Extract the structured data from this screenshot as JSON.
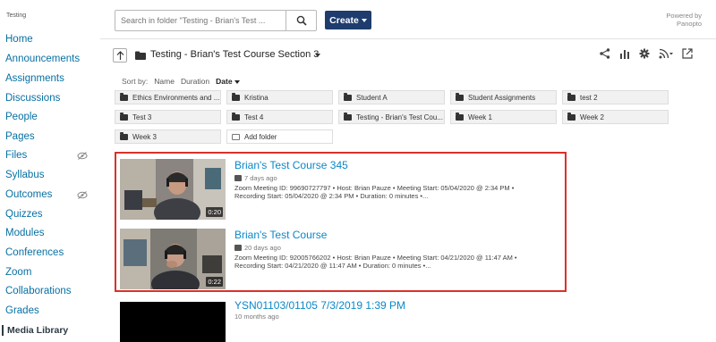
{
  "nav": {
    "course_crumb": "Testing",
    "items": [
      {
        "label": "Home",
        "hidden": false,
        "active": false
      },
      {
        "label": "Announcements",
        "hidden": false,
        "active": false
      },
      {
        "label": "Assignments",
        "hidden": false,
        "active": false
      },
      {
        "label": "Discussions",
        "hidden": false,
        "active": false
      },
      {
        "label": "People",
        "hidden": false,
        "active": false
      },
      {
        "label": "Pages",
        "hidden": false,
        "active": false
      },
      {
        "label": "Files",
        "hidden": true,
        "active": false
      },
      {
        "label": "Syllabus",
        "hidden": false,
        "active": false
      },
      {
        "label": "Outcomes",
        "hidden": true,
        "active": false
      },
      {
        "label": "Quizzes",
        "hidden": false,
        "active": false
      },
      {
        "label": "Modules",
        "hidden": false,
        "active": false
      },
      {
        "label": "Conferences",
        "hidden": false,
        "active": false
      },
      {
        "label": "Zoom",
        "hidden": false,
        "active": false
      },
      {
        "label": "Collaborations",
        "hidden": false,
        "active": false
      },
      {
        "label": "Grades",
        "hidden": false,
        "active": false
      },
      {
        "label": "Media Library",
        "hidden": false,
        "active": true
      }
    ]
  },
  "toolbar": {
    "search_placeholder": "Search in folder \"Testing - Brian's Test ...",
    "create_label": "Create",
    "powered_line1": "Powered by",
    "powered_line2": "Panopto"
  },
  "folder": {
    "title": "Testing - Brian's Test Course Section 3"
  },
  "sort": {
    "label": "Sort by:",
    "options": [
      "Name",
      "Duration",
      "Date"
    ],
    "selected": "Date"
  },
  "subfolders": [
    "Ethics Environments and ...",
    "Kristina",
    "Student A",
    "Student Assignments",
    "test 2",
    "Test 3",
    "Test 4",
    "Testing - Brian's Test Cou...",
    "Week 1",
    "Week 2",
    "Week 3"
  ],
  "add_folder_label": "Add folder",
  "sessions": [
    {
      "title": "Brian's Test Course 345",
      "age": "7 days ago",
      "duration": "0:20",
      "desc": "Zoom Meeting ID: 99690727797  • Host: Brian Pauze  • Meeting Start: 05/04/2020 @ 2:34 PM  • Recording Start: 05/04/2020 @ 2:34 PM  • Duration: 0 minutes  •..."
    },
    {
      "title": "Brian's Test Course",
      "age": "20 days ago",
      "duration": "0:22",
      "desc": "Zoom Meeting ID: 92005766202  • Host: Brian Pauze  • Meeting Start: 04/21/2020 @ 11:47 AM  • Recording Start: 04/21/2020 @ 11:47 AM  • Duration: 0 minutes  •..."
    },
    {
      "title": "YSN01103/01105 7/3/2019 1:39 PM",
      "age": "10 months ago"
    }
  ],
  "colors": {
    "nav_link": "#0770a3",
    "create_button": "#1e3c6e",
    "session_title": "#0a88c8",
    "highlight_border": "#d9312b"
  }
}
